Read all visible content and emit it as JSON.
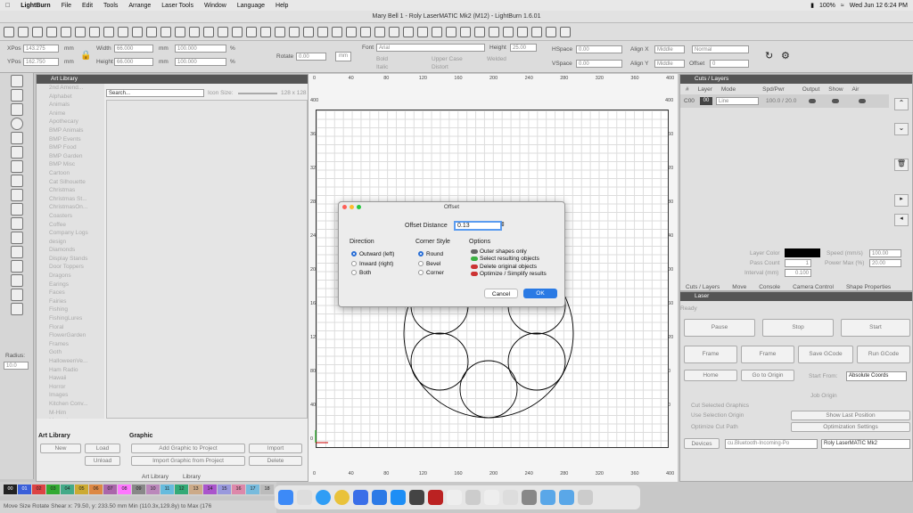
{
  "menubar": {
    "apple": "",
    "app": "LightBurn",
    "items": [
      "File",
      "Edit",
      "Tools",
      "Arrange",
      "Laser Tools",
      "Window",
      "Language",
      "Help"
    ],
    "battery": "100%",
    "clock": "Wed Jun 12  6:24 PM"
  },
  "window": {
    "title": "Mary Bell 1 - Roly LaserMATIC Mk2 (M12) - LightBurn 1.6.01"
  },
  "props": {
    "xpos_label": "XPos",
    "xpos": "143.275",
    "ypos_label": "YPos",
    "ypos": "162.750",
    "unit": "mm",
    "width_label": "Width",
    "width": "66.000",
    "height_label": "Height",
    "height": "66.000",
    "wpct": "100.000",
    "hpct": "100.000",
    "pct": "%",
    "rotate_label": "Rotate",
    "rotate": "0.00",
    "mm_btn": "mm",
    "font_label": "Font",
    "font": "Arial",
    "fheight_label": "Height",
    "fheight": "25.00",
    "hspace_label": "HSpace",
    "hspace": "0.00",
    "vspace_label": "VSpace",
    "vspace": "0.00",
    "alignx_label": "Align X",
    "alignx": "Middle",
    "aligny_label": "Align Y",
    "aligny": "Middle",
    "normal": "Normal",
    "offset_label": "Offset",
    "offset": "0",
    "bold": "Bold",
    "italic": "Italic",
    "uppercase": "Upper Case",
    "distort": "Distort",
    "welded": "Welded"
  },
  "artlib": {
    "title": "Art Library",
    "search_label": "Search...",
    "icon_size_label": "Icon Size:",
    "icon_size": "128 x 128",
    "categories": [
      "2nd Amend...",
      "Alphabet",
      "Animals",
      "Anime",
      "Apothecary",
      "BMP Animals",
      "BMP Events",
      "BMP Food",
      "BMP Garden",
      "BMP Misc",
      "Cartoon",
      "Cat Silhouette",
      "Christmas",
      "Christmas St...",
      "ChristmasOn...",
      "Coasters",
      "Coffee",
      "Company Logs",
      "design",
      "Diamonds",
      "Display Stands",
      "Door Toppers",
      "Dragons",
      "Earings",
      "Faces",
      "Fairies",
      "Fishing",
      "FishingLures",
      "Floral",
      "FlowerGarden",
      "Frames",
      "Goth",
      "HalloweenVe...",
      "Ham Radio",
      "Hawaii",
      "Horror",
      "Images",
      "Kitchen Conv...",
      "M-Him",
      "Masonic"
    ],
    "section_art": "Art Library",
    "section_graphic": "Graphic",
    "new": "New",
    "load": "Load",
    "unload": "Unload",
    "add_graphic": "Add Graphic to Project",
    "import_graphic": "Import Graphic from Project",
    "import": "Import",
    "delete": "Delete",
    "tab1": "Art Library",
    "tab2": "Library"
  },
  "left": {
    "radius_label": "Radius:",
    "radius": "10.0"
  },
  "canvas": {
    "xticks": [
      "0",
      "40",
      "80",
      "120",
      "160",
      "200",
      "240",
      "280",
      "320",
      "360",
      "400"
    ],
    "yticks": [
      "400",
      "360",
      "320",
      "280",
      "240",
      "200",
      "160",
      "120",
      "80",
      "40",
      "0"
    ]
  },
  "dialog": {
    "title": "Offset",
    "distance_label": "Offset Distance",
    "distance": "0.13",
    "direction_label": "Direction",
    "directions": [
      "Outward (left)",
      "Inward (right)",
      "Both"
    ],
    "corner_label": "Corner Style",
    "corners": [
      "Round",
      "Bevel",
      "Corner"
    ],
    "options_label": "Options",
    "options": [
      "Outer shapes only",
      "Select resulting objects",
      "Delete original objects",
      "Optimize / Simplify results"
    ],
    "cancel": "Cancel",
    "ok": "OK"
  },
  "cuts": {
    "title": "Cuts / Layers",
    "headers": [
      "#",
      "Layer",
      "Mode",
      "Spd/Pwr",
      "Output",
      "Show",
      "Air"
    ],
    "row": {
      "id": "C00",
      "layer": "00",
      "mode": "Line",
      "spdpwr": "100.0 / 20.0"
    },
    "layer_color_label": "Layer Color",
    "speed_label": "Speed (mm/s)",
    "speed": "100.00",
    "pass_label": "Pass Count",
    "pass": "1",
    "power_label": "Power Max (%)",
    "power": "20.00",
    "interval_label": "Interval (mm)",
    "interval": "0.100",
    "tabs": [
      "Cuts / Layers",
      "Move",
      "Console",
      "Camera Control",
      "Shape Properties"
    ]
  },
  "laser": {
    "title": "Laser",
    "status": "Ready",
    "pause": "Pause",
    "stop": "Stop",
    "start": "Start",
    "frame1": "Frame",
    "frame2": "Frame",
    "save_gcode": "Save GCode",
    "run_gcode": "Run GCode",
    "home": "Home",
    "goto_origin": "Go to Origin",
    "start_from_label": "Start From:",
    "start_from": "Absolute Coords",
    "job_origin_label": "Job Origin",
    "cut_selected": "Cut Selected Graphics",
    "use_selection": "Use Selection Origin",
    "optimize_cut": "Optimize Cut Path",
    "show_last": "Show Last Position",
    "opt_settings": "Optimization Settings",
    "devices": "Devices",
    "port": "cu.Bluetooth-Incoming-Po",
    "device": "Roly LaserMATIC Mk2"
  },
  "palette": [
    "00",
    "01",
    "02",
    "03",
    "04",
    "05",
    "06",
    "07",
    "08",
    "09",
    "10",
    "11",
    "12",
    "13",
    "14",
    "15",
    "16",
    "17",
    "18"
  ],
  "palette_colors": [
    "#222",
    "#3a5fd9",
    "#d44",
    "#3a3",
    "#4a8",
    "#ca3",
    "#d84",
    "#a6a",
    "#f7f",
    "#888",
    "#b8b",
    "#6bd",
    "#3a7",
    "#ca8",
    "#a5c",
    "#99d",
    "#d8a",
    "#7bd",
    "#bbb"
  ],
  "status": {
    "text": "Move  Size  Rotate  Shear    x: 79.50, y: 233.50 mm    Min (110.3x,129.8y) to Max (176"
  }
}
